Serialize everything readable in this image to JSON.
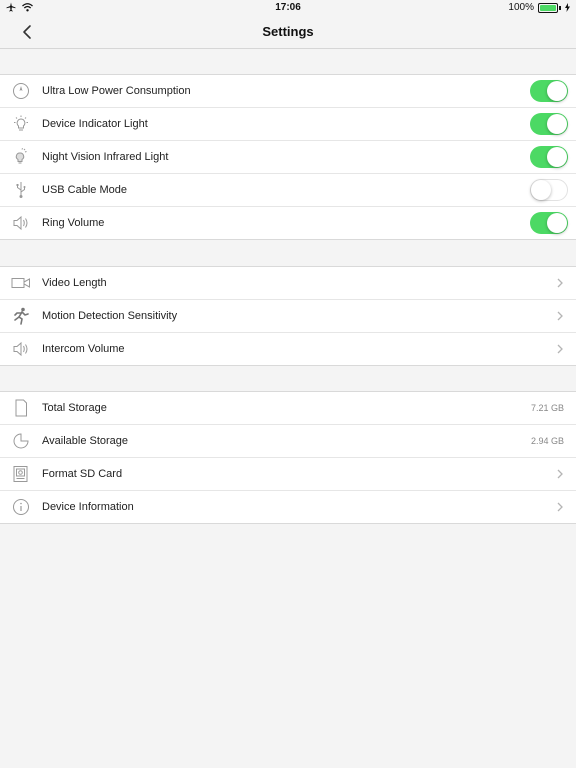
{
  "status_bar": {
    "time": "17:06",
    "battery": "100%"
  },
  "nav": {
    "title": "Settings"
  },
  "group1": [
    {
      "label": "Ultra Low Power Consumption",
      "icon": "power-icon",
      "toggle": true
    },
    {
      "label": "Device Indicator Light",
      "icon": "bulb-icon",
      "toggle": true
    },
    {
      "label": "Night Vision Infrared Light",
      "icon": "infrared-bulb-icon",
      "toggle": true
    },
    {
      "label": "USB Cable Mode",
      "icon": "usb-icon",
      "toggle": false
    },
    {
      "label": "Ring Volume",
      "icon": "speaker-icon",
      "toggle": true
    }
  ],
  "group2": [
    {
      "label": "Video Length",
      "icon": "video-camera-icon"
    },
    {
      "label": "Motion Detection Sensitivity",
      "icon": "running-person-icon"
    },
    {
      "label": "Intercom Volume",
      "icon": "speaker-icon"
    }
  ],
  "group3": [
    {
      "label": "Total Storage",
      "icon": "sd-card-icon",
      "value": "7.21 GB"
    },
    {
      "label": "Available Storage",
      "icon": "pie-chart-icon",
      "value": "2.94 GB"
    },
    {
      "label": "Format SD Card",
      "icon": "format-icon"
    },
    {
      "label": "Device Information",
      "icon": "info-icon"
    }
  ],
  "colors": {
    "accent_green": "#4cd964",
    "background": "#f4f4f4"
  }
}
